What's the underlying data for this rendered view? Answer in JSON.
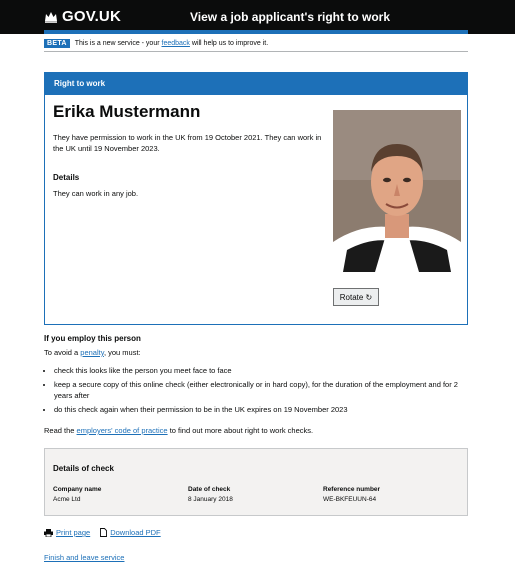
{
  "header": {
    "logo_text": "GOV.UK",
    "service_name": "View a job applicant's right to work"
  },
  "beta": {
    "tag": "BETA",
    "text_before": "This is a new service - your",
    "feedback_link": "feedback",
    "text_after": "will help us to improve it."
  },
  "card": {
    "heading": "Right to work",
    "person_name": "Erika Mustermann",
    "permission_text": "They have permission to work in the UK from 19 October 2021. They can work in the UK until 19 November 2023.",
    "details_heading": "Details",
    "details_text": "They can work in any job.",
    "rotate_label": "Rotate ↻"
  },
  "employ": {
    "heading": "If you employ this person",
    "avoid_before": "To avoid a",
    "penalty_link": "penalty",
    "avoid_after": ", you must:",
    "items": [
      "check this looks like the person you meet face to face",
      "keep a secure copy of this online check (either electronically or in hard copy), for the duration of the employment and for 2 years after",
      "do this check again when their permission to be in the UK expires on 19 November 2023"
    ],
    "code_before": "Read the",
    "code_link": "employers' code of practice",
    "code_after": "to find out more about right to work checks."
  },
  "check": {
    "heading": "Details of check",
    "company_label": "Company name",
    "company_value": "Acme Ltd",
    "date_label": "Date of check",
    "date_value": "8 January 2018",
    "ref_label": "Reference number",
    "ref_value": "WE-BKFEUUN-64"
  },
  "links": {
    "print": "Print page",
    "download": "Download PDF",
    "finish": "Finish and leave service"
  },
  "colors": {
    "brand_blue": "#1d70b8",
    "header_black": "#0b0c0c",
    "panel_grey": "#f3f2f1"
  }
}
